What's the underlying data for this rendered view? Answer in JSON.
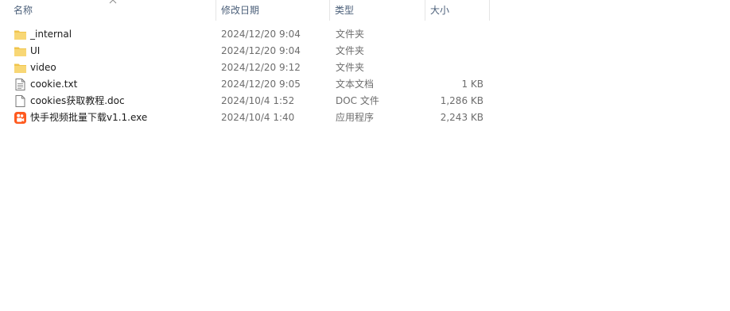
{
  "columns": {
    "name": "名称",
    "date": "修改日期",
    "type": "类型",
    "size": "大小"
  },
  "sort": {
    "column": "name",
    "icon": "chevron-up-icon"
  },
  "files": [
    {
      "name": "_internal",
      "date": "2024/12/20 9:04",
      "type": "文件夹",
      "size": "",
      "icon": "folder-icon"
    },
    {
      "name": "UI",
      "date": "2024/12/20 9:04",
      "type": "文件夹",
      "size": "",
      "icon": "folder-icon"
    },
    {
      "name": "video",
      "date": "2024/12/20 9:12",
      "type": "文件夹",
      "size": "",
      "icon": "folder-icon"
    },
    {
      "name": "cookie.txt",
      "date": "2024/12/20 9:05",
      "type": "文本文档",
      "size": "1 KB",
      "icon": "text-file-icon"
    },
    {
      "name": "cookies获取教程.doc",
      "date": "2024/10/4 1:52",
      "type": "DOC 文件",
      "size": "1,286 KB",
      "icon": "document-file-icon"
    },
    {
      "name": "快手视频批量下载v1.1.exe",
      "date": "2024/10/4 1:40",
      "type": "应用程序",
      "size": "2,243 KB",
      "icon": "app-exe-icon"
    }
  ],
  "colors": {
    "header_text": "#4c607a",
    "folder": "#f8d775",
    "app_icon": "#ff5a1f"
  }
}
